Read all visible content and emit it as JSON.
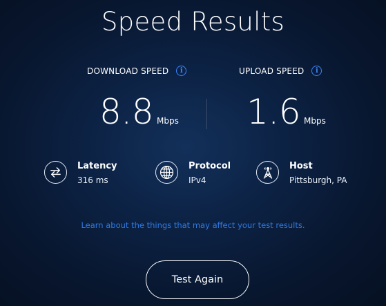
{
  "page": {
    "title": "Speed Results"
  },
  "download": {
    "label": "DOWNLOAD SPEED",
    "value": "8.8",
    "unit": "Mbps",
    "info_icon": "info-icon"
  },
  "upload": {
    "label": "UPLOAD SPEED",
    "value": "1.6",
    "unit": "Mbps",
    "info_icon": "info-icon"
  },
  "details": {
    "latency": {
      "label": "Latency",
      "value": "316 ms",
      "icon": "swap-arrows-icon"
    },
    "protocol": {
      "label": "Protocol",
      "value": "IPv4",
      "icon": "globe-icon"
    },
    "host": {
      "label": "Host",
      "value": "Pittsburgh, PA",
      "icon": "tower-icon"
    }
  },
  "learn_link": "Learn about the things that may affect your test results.",
  "actions": {
    "test_again": "Test Again"
  },
  "colors": {
    "accent": "#3a86ff",
    "link": "#2f7ae0",
    "background": "#0c2244"
  }
}
